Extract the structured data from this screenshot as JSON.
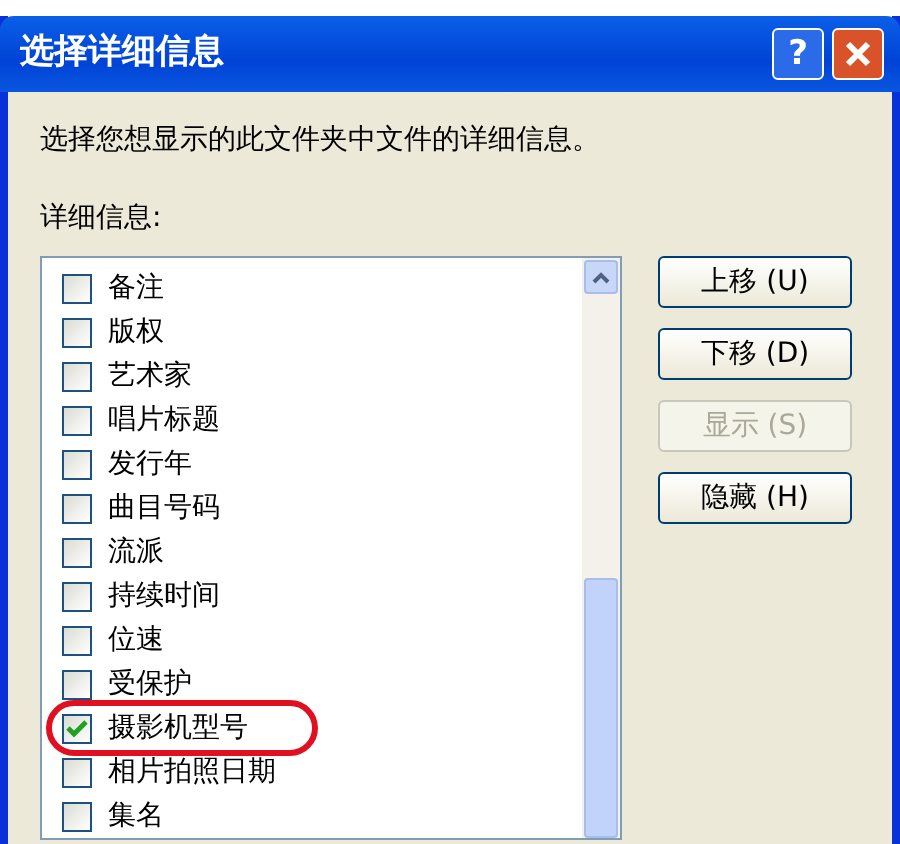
{
  "window": {
    "title": "选择详细信息",
    "help_button": "?"
  },
  "instruction": "选择您想显示的此文件夹中文件的详细信息。",
  "list_label": "详细信息:",
  "items": [
    {
      "label": "备注",
      "checked": false,
      "circled": false
    },
    {
      "label": "版权",
      "checked": false,
      "circled": false
    },
    {
      "label": "艺术家",
      "checked": false,
      "circled": false
    },
    {
      "label": "唱片标题",
      "checked": false,
      "circled": false
    },
    {
      "label": "发行年",
      "checked": false,
      "circled": false
    },
    {
      "label": "曲目号码",
      "checked": false,
      "circled": false
    },
    {
      "label": "流派",
      "checked": false,
      "circled": false
    },
    {
      "label": "持续时间",
      "checked": false,
      "circled": false
    },
    {
      "label": "位速",
      "checked": false,
      "circled": false
    },
    {
      "label": "受保护",
      "checked": false,
      "circled": false
    },
    {
      "label": "摄影机型号",
      "checked": true,
      "circled": true
    },
    {
      "label": "相片拍照日期",
      "checked": false,
      "circled": false
    },
    {
      "label": "集名",
      "checked": false,
      "circled": false
    }
  ],
  "buttons": [
    {
      "label": "上移 (U)",
      "disabled": false
    },
    {
      "label": "下移 (D)",
      "disabled": false
    },
    {
      "label": "显示 (S)",
      "disabled": true
    },
    {
      "label": "隐藏 (H)",
      "disabled": false
    }
  ]
}
